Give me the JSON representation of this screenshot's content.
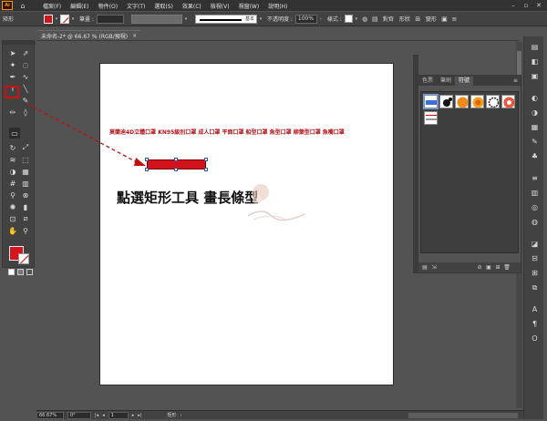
{
  "app": {
    "logo": "Ai",
    "menus": [
      "檔案(F)",
      "編輯(E)",
      "物件(O)",
      "文字(T)",
      "選取(S)",
      "效果(C)",
      "檢視(V)",
      "視窗(W)",
      "說明(H)"
    ]
  },
  "control_bar": {
    "tool_name": "矩形",
    "stroke_label": "筆畫 :",
    "stroke_profile": "基本",
    "opacity_label": "不透明度 :",
    "opacity_value": "100%",
    "style_label": "樣式 :",
    "align_label": "對齊",
    "shape_label": "形狀",
    "transform_label": "變形"
  },
  "document": {
    "tab_label": "未命名-2* @ 66.67 % (RGB/預視)"
  },
  "canvas": {
    "product_line": "莫蘭迪4D立體口罩  KN95級別口罩  成人口罩  平面口罩  船型口罩  魚型口罩  柳葉型口罩  魚嘴口罩",
    "instruction": "點選矩形工具 畫長條型"
  },
  "symbols_panel": {
    "tabs": [
      "色票",
      "筆刷",
      "符號"
    ],
    "active_tab": "符號",
    "menu": "≡"
  },
  "status_bar": {
    "zoom": "66.67%",
    "rotation": "0°",
    "page": "1",
    "tool": "矩形"
  },
  "colors": {
    "fill": "#d3131c",
    "highlight": "#d01010",
    "artboard": "#ffffff",
    "workspace": "#535353",
    "instruction_text": "#111111",
    "product_text": "#b4141a"
  },
  "icons": {
    "home": "home-icon",
    "rectangle_tool": "rectangle-tool-icon",
    "selection_tool": "selection-tool-icon"
  }
}
